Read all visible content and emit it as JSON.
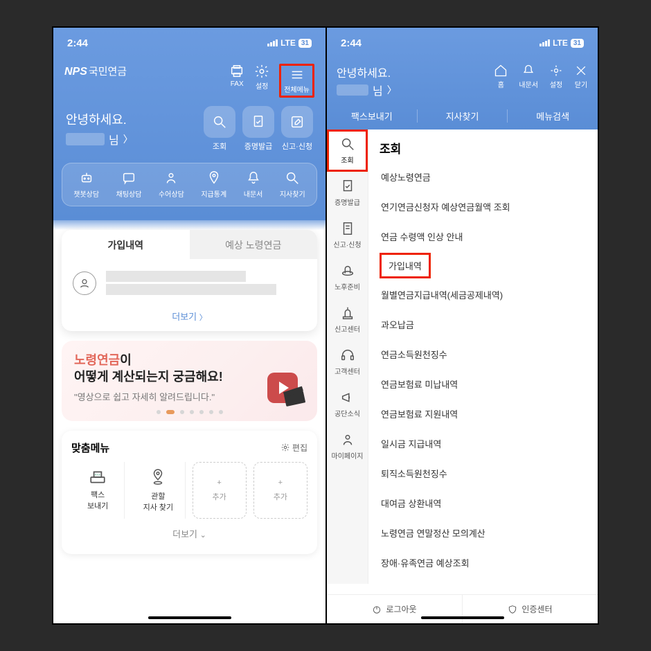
{
  "status": {
    "time": "2:44",
    "network": "LTE",
    "battery": "31"
  },
  "left": {
    "logo": "NPS",
    "logo_sub": "국민연금",
    "top_icons": {
      "fax": "FAX",
      "settings": "설정",
      "menu": "전체메뉴"
    },
    "greeting": "안녕하세요.",
    "name_suffix": "님",
    "actions": {
      "search": "조회",
      "cert": "증명발급",
      "report": "신고·신청"
    },
    "quick": {
      "chatbot": "챗봇상담",
      "chat": "채팅상담",
      "sign": "수어상담",
      "delay": "지급통계",
      "mydoc": "내문서",
      "branch": "지사찾기"
    },
    "tabs": {
      "tab1": "가입내역",
      "tab2": "예상 노령연금",
      "more": "더보기"
    },
    "banner": {
      "line1_accent": "노령연금",
      "line1_rest": "이",
      "line2": "어떻게 계산되는지 궁금해요!",
      "sub": "\"영상으로 쉽고 자세히 알려드립니다.\""
    },
    "custom": {
      "title": "맞춤메뉴",
      "edit": "편집",
      "fax": "팩스\n보내기",
      "branch": "관할\n지사 찾기",
      "add": "추가",
      "more": "더보기"
    }
  },
  "right": {
    "greeting": "안녕하세요.",
    "name_suffix": "님",
    "icons": {
      "home": "홈",
      "mydoc": "내문서",
      "settings": "설정",
      "close": "닫기"
    },
    "subnav": {
      "fax": "팩스보내기",
      "branch": "지사찾기",
      "search": "메뉴검색"
    },
    "rail": {
      "search": "조회",
      "cert": "증명발급",
      "report": "신고·신청",
      "retire": "노후준비",
      "alert": "신고센터",
      "cs": "고객센터",
      "news": "공단소식",
      "mypage": "마이페이지"
    },
    "menu": {
      "title": "조회",
      "items": {
        "i1": "예상노령연금",
        "i2": "연기연금신청자 예상연금월액 조회",
        "i3": "연금 수령액 인상 안내",
        "i4": "가입내역",
        "i5": "월별연금지급내역(세금공제내역)",
        "i6": "과오납금",
        "i7": "연금소득원천징수",
        "i8": "연금보험료 미납내역",
        "i9": "연금보험료 지원내역",
        "i10": "일시금 지급내역",
        "i11": "퇴직소득원천징수",
        "i12": "대여금 상환내역",
        "i13": "노령연금 연말정산 모의계산",
        "i14": "장애·유족연금 예상조회"
      }
    },
    "footer": {
      "logout": "로그아웃",
      "auth": "인증센터"
    }
  }
}
